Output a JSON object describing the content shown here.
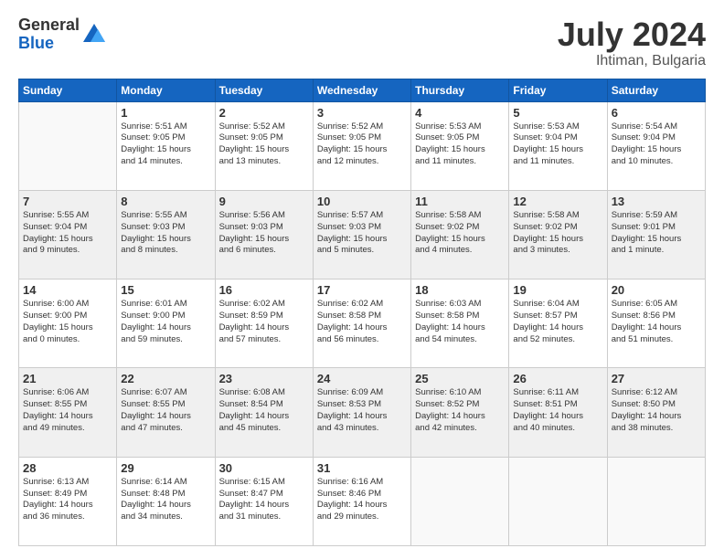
{
  "logo": {
    "general": "General",
    "blue": "Blue"
  },
  "title": {
    "month_year": "July 2024",
    "location": "Ihtiman, Bulgaria"
  },
  "headers": [
    "Sunday",
    "Monday",
    "Tuesday",
    "Wednesday",
    "Thursday",
    "Friday",
    "Saturday"
  ],
  "weeks": [
    [
      {
        "day": "",
        "info": ""
      },
      {
        "day": "1",
        "info": "Sunrise: 5:51 AM\nSunset: 9:05 PM\nDaylight: 15 hours\nand 14 minutes."
      },
      {
        "day": "2",
        "info": "Sunrise: 5:52 AM\nSunset: 9:05 PM\nDaylight: 15 hours\nand 13 minutes."
      },
      {
        "day": "3",
        "info": "Sunrise: 5:52 AM\nSunset: 9:05 PM\nDaylight: 15 hours\nand 12 minutes."
      },
      {
        "day": "4",
        "info": "Sunrise: 5:53 AM\nSunset: 9:05 PM\nDaylight: 15 hours\nand 11 minutes."
      },
      {
        "day": "5",
        "info": "Sunrise: 5:53 AM\nSunset: 9:04 PM\nDaylight: 15 hours\nand 11 minutes."
      },
      {
        "day": "6",
        "info": "Sunrise: 5:54 AM\nSunset: 9:04 PM\nDaylight: 15 hours\nand 10 minutes."
      }
    ],
    [
      {
        "day": "7",
        "info": "Sunrise: 5:55 AM\nSunset: 9:04 PM\nDaylight: 15 hours\nand 9 minutes."
      },
      {
        "day": "8",
        "info": "Sunrise: 5:55 AM\nSunset: 9:03 PM\nDaylight: 15 hours\nand 8 minutes."
      },
      {
        "day": "9",
        "info": "Sunrise: 5:56 AM\nSunset: 9:03 PM\nDaylight: 15 hours\nand 6 minutes."
      },
      {
        "day": "10",
        "info": "Sunrise: 5:57 AM\nSunset: 9:03 PM\nDaylight: 15 hours\nand 5 minutes."
      },
      {
        "day": "11",
        "info": "Sunrise: 5:58 AM\nSunset: 9:02 PM\nDaylight: 15 hours\nand 4 minutes."
      },
      {
        "day": "12",
        "info": "Sunrise: 5:58 AM\nSunset: 9:02 PM\nDaylight: 15 hours\nand 3 minutes."
      },
      {
        "day": "13",
        "info": "Sunrise: 5:59 AM\nSunset: 9:01 PM\nDaylight: 15 hours\nand 1 minute."
      }
    ],
    [
      {
        "day": "14",
        "info": "Sunrise: 6:00 AM\nSunset: 9:00 PM\nDaylight: 15 hours\nand 0 minutes."
      },
      {
        "day": "15",
        "info": "Sunrise: 6:01 AM\nSunset: 9:00 PM\nDaylight: 14 hours\nand 59 minutes."
      },
      {
        "day": "16",
        "info": "Sunrise: 6:02 AM\nSunset: 8:59 PM\nDaylight: 14 hours\nand 57 minutes."
      },
      {
        "day": "17",
        "info": "Sunrise: 6:02 AM\nSunset: 8:58 PM\nDaylight: 14 hours\nand 56 minutes."
      },
      {
        "day": "18",
        "info": "Sunrise: 6:03 AM\nSunset: 8:58 PM\nDaylight: 14 hours\nand 54 minutes."
      },
      {
        "day": "19",
        "info": "Sunrise: 6:04 AM\nSunset: 8:57 PM\nDaylight: 14 hours\nand 52 minutes."
      },
      {
        "day": "20",
        "info": "Sunrise: 6:05 AM\nSunset: 8:56 PM\nDaylight: 14 hours\nand 51 minutes."
      }
    ],
    [
      {
        "day": "21",
        "info": "Sunrise: 6:06 AM\nSunset: 8:55 PM\nDaylight: 14 hours\nand 49 minutes."
      },
      {
        "day": "22",
        "info": "Sunrise: 6:07 AM\nSunset: 8:55 PM\nDaylight: 14 hours\nand 47 minutes."
      },
      {
        "day": "23",
        "info": "Sunrise: 6:08 AM\nSunset: 8:54 PM\nDaylight: 14 hours\nand 45 minutes."
      },
      {
        "day": "24",
        "info": "Sunrise: 6:09 AM\nSunset: 8:53 PM\nDaylight: 14 hours\nand 43 minutes."
      },
      {
        "day": "25",
        "info": "Sunrise: 6:10 AM\nSunset: 8:52 PM\nDaylight: 14 hours\nand 42 minutes."
      },
      {
        "day": "26",
        "info": "Sunrise: 6:11 AM\nSunset: 8:51 PM\nDaylight: 14 hours\nand 40 minutes."
      },
      {
        "day": "27",
        "info": "Sunrise: 6:12 AM\nSunset: 8:50 PM\nDaylight: 14 hours\nand 38 minutes."
      }
    ],
    [
      {
        "day": "28",
        "info": "Sunrise: 6:13 AM\nSunset: 8:49 PM\nDaylight: 14 hours\nand 36 minutes."
      },
      {
        "day": "29",
        "info": "Sunrise: 6:14 AM\nSunset: 8:48 PM\nDaylight: 14 hours\nand 34 minutes."
      },
      {
        "day": "30",
        "info": "Sunrise: 6:15 AM\nSunset: 8:47 PM\nDaylight: 14 hours\nand 31 minutes."
      },
      {
        "day": "31",
        "info": "Sunrise: 6:16 AM\nSunset: 8:46 PM\nDaylight: 14 hours\nand 29 minutes."
      },
      {
        "day": "",
        "info": ""
      },
      {
        "day": "",
        "info": ""
      },
      {
        "day": "",
        "info": ""
      }
    ]
  ]
}
